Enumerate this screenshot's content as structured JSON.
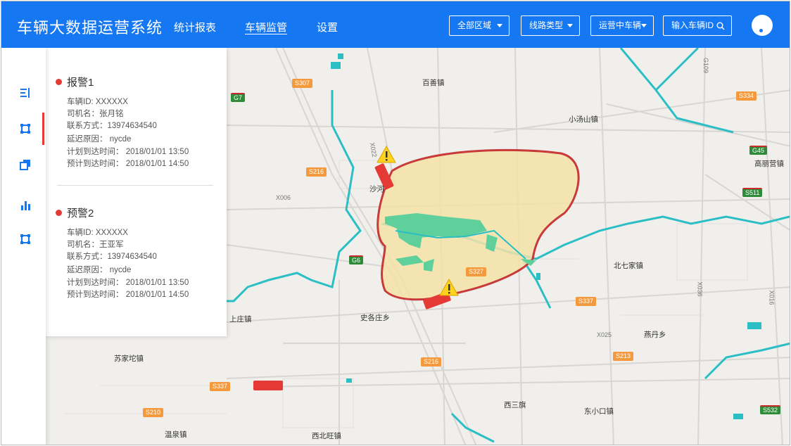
{
  "header": {
    "title": "车辆大数据运营系统",
    "nav": [
      "统计报表",
      "车辆监管",
      "设置"
    ],
    "active_nav": "车辆监管",
    "filters": [
      "全部区域",
      "线路类型",
      "运营中车辆"
    ],
    "search_label": "输入车辆ID"
  },
  "alerts": [
    {
      "title": "报警1",
      "vehicle_id": "车辆ID: XXXXXX",
      "driver": "司机名：张月铭",
      "contact": "联系方式：13974634540",
      "delay_reason": "延迟原因： nycde",
      "planned_arrival": "计划到达时间： 2018/01/01   13:50",
      "expected_arrival": "预计到达时间： 2018/01/01   14:50"
    },
    {
      "title": "预警2",
      "vehicle_id": "车辆ID: XXXXXX",
      "driver": "司机名：王亚军",
      "contact": "联系方式：13974634540",
      "delay_reason": "延迟原因： nycde",
      "planned_arrival": "计划到达时间： 2018/01/01   13:50",
      "expected_arrival": "预计到达时间： 2018/01/01   14:50"
    }
  ],
  "map": {
    "places": [
      "百善镇",
      "小汤山镇",
      "高丽营镇",
      "沙河",
      "北七家镇",
      "史各庄乡",
      "上庄镇",
      "燕丹乡",
      "苏家坨镇",
      "西三旗",
      "东小口镇",
      "温泉镇",
      "西北旺镇"
    ],
    "road_shields": [
      "S307",
      "G7",
      "S334",
      "G45",
      "S216",
      "S511",
      "G6",
      "S327",
      "S337",
      "S337",
      "S213",
      "S216",
      "S337",
      "S210",
      "S532"
    ],
    "road_labels": [
      "X006",
      "X022",
      "X025",
      "X036",
      "G109",
      "X016"
    ]
  },
  "colors": {
    "primary": "#1677f2",
    "alert": "#e53935",
    "geofence_fill": "#f3e2a8",
    "geofence_stroke": "#c83a3a",
    "water": "#2bbfc5",
    "park": "#5fcf9c"
  }
}
